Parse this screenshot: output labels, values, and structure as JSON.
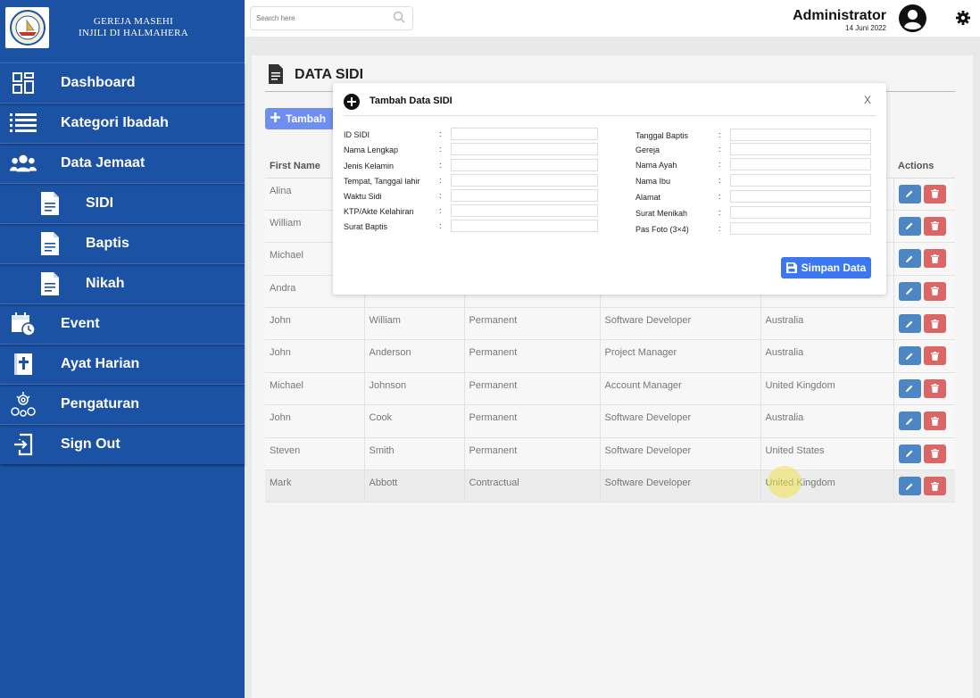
{
  "brand": {
    "line1": "GEREJA MASEHI",
    "line2": "INJILI DI HALMAHERA"
  },
  "nav": {
    "dashboard": "Dashboard",
    "kategori": "Kategori Ibadah",
    "jemaat": "Data Jemaat",
    "sidi": "SIDI",
    "baptis": "Baptis",
    "nikah": "Nikah",
    "event": "Event",
    "ayat": "Ayat Harian",
    "pengaturan": "Pengaturan",
    "signout": "Sign Out"
  },
  "topbar": {
    "search_placeholder": "Search here",
    "admin_name": "Administrator",
    "date": "14 Juni 2022"
  },
  "page": {
    "title": "DATA SIDI",
    "add_label": "Tambah"
  },
  "table": {
    "headers": [
      "First Name",
      "",
      "",
      "",
      "",
      "Actions"
    ],
    "rows": [
      [
        "Alina",
        "",
        "",
        "",
        ""
      ],
      [
        "William",
        "",
        "",
        "",
        ""
      ],
      [
        "Michael",
        "",
        "",
        "",
        ""
      ],
      [
        "Andra",
        "",
        "",
        "",
        ""
      ],
      [
        "John",
        "William",
        "Permanent",
        "Software Developer",
        "Australia"
      ],
      [
        "John",
        "Anderson",
        "Permanent",
        "Project Manager",
        "Australia"
      ],
      [
        "Michael",
        "Johnson",
        "Permanent",
        "Account Manager",
        "United Kingdom"
      ],
      [
        "John",
        "Cook",
        "Permanent",
        "Software Developer",
        "Australia"
      ],
      [
        "Steven",
        "Smith",
        "Permanent",
        "Software Developer",
        "United States"
      ],
      [
        "Mark",
        "Abbott",
        "Contractual",
        "Software Developer",
        "United Kingdom"
      ]
    ]
  },
  "modal": {
    "title": "Tambah Data SIDI",
    "close": "X",
    "left_fields": [
      "ID SIDI",
      "Nama Lengkap",
      "Jenis Kelamin",
      "Tempat, Tanggal lahir",
      "Waktu Sidi",
      "KTP/Akte Kelahiran",
      "Surat Baptis"
    ],
    "right_fields": [
      "Tanggal Baptis",
      "Gereja",
      "Nama Ayah",
      "Nama Ibu",
      "Alamat",
      "Surat Menikah",
      "Pas Foto (3×4)"
    ],
    "colon": ":",
    "save_label": "Simpan Data"
  }
}
